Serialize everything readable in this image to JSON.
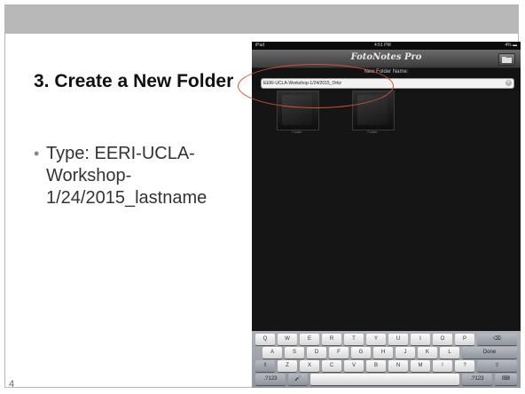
{
  "slide": {
    "title": "3. Create a New Folder",
    "bullet": "Type: EERI-UCLA-Workshop-1/24/2015_lastname",
    "page_number": "4",
    "colors": {
      "header_bar": "#b8b8b8",
      "highlight_ellipse": "#d94a3a"
    }
  },
  "ipad": {
    "status": {
      "carrier": "iPad",
      "time": "4:51 PM",
      "battery": "4% ▬"
    },
    "app_title": "FotoNotes Pro",
    "nav_icon": "folder-icon",
    "folder_field_label": "New Folder Name:",
    "folder_name_value": "EERI-UCLA-Workshop-1/24/2015_Ortiz",
    "thumbnails": [
      {
        "label": "Folder"
      },
      {
        "label": "Folder"
      }
    ],
    "keyboard": {
      "row1": [
        "Q",
        "W",
        "E",
        "R",
        "T",
        "Y",
        "U",
        "I",
        "O",
        "P",
        "⌫"
      ],
      "row2": [
        "A",
        "S",
        "D",
        "F",
        "G",
        "H",
        "J",
        "K",
        "L",
        "Done"
      ],
      "row3": [
        "⇧",
        "Z",
        "X",
        "C",
        "V",
        "B",
        "N",
        "M",
        "!",
        "?",
        "⇧"
      ],
      "row4": [
        ".?123",
        "🎤",
        "",
        ".?123",
        "⌨"
      ]
    }
  }
}
